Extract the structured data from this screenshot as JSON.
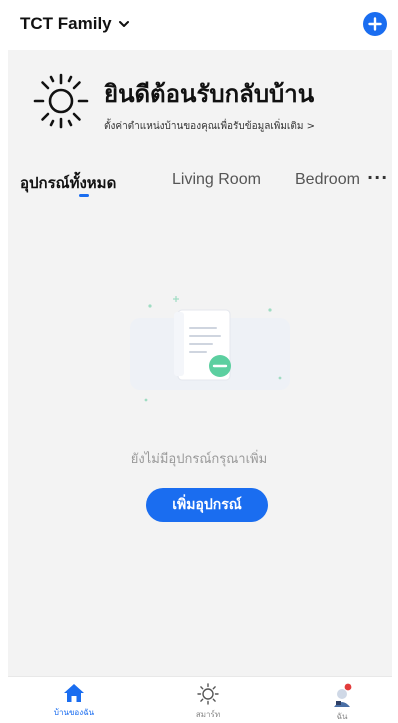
{
  "header": {
    "family_name": "TCT Family",
    "accent_color": "#1a6df0"
  },
  "welcome": {
    "title": "ยินดีต้อนรับกลับบ้าน",
    "subtitle": "ตั้งค่าตำแหน่งบ้านของคุณเพื่อรับข้อมูลเพิ่มเติม >",
    "icon": "sun-icon"
  },
  "tabs": [
    {
      "label": "อุปกรณ์ทั้งหมด",
      "selected": true
    },
    {
      "label": "Living Room",
      "selected": false
    },
    {
      "label": "Bedroom",
      "selected": false
    }
  ],
  "tabs_more": "···",
  "empty_state": {
    "message": "ยังไม่มีอุปกรณ์กรุณาเพิ่ม",
    "button_label": "เพิ่มอุปกรณ์"
  },
  "bottom_nav": [
    {
      "label": "บ้านของฉัน",
      "icon": "home-icon",
      "active": true
    },
    {
      "label": "สมาร์ท",
      "icon": "sun-outline-icon",
      "active": false
    },
    {
      "label": "ฉัน",
      "icon": "avatar-icon",
      "active": false
    }
  ]
}
